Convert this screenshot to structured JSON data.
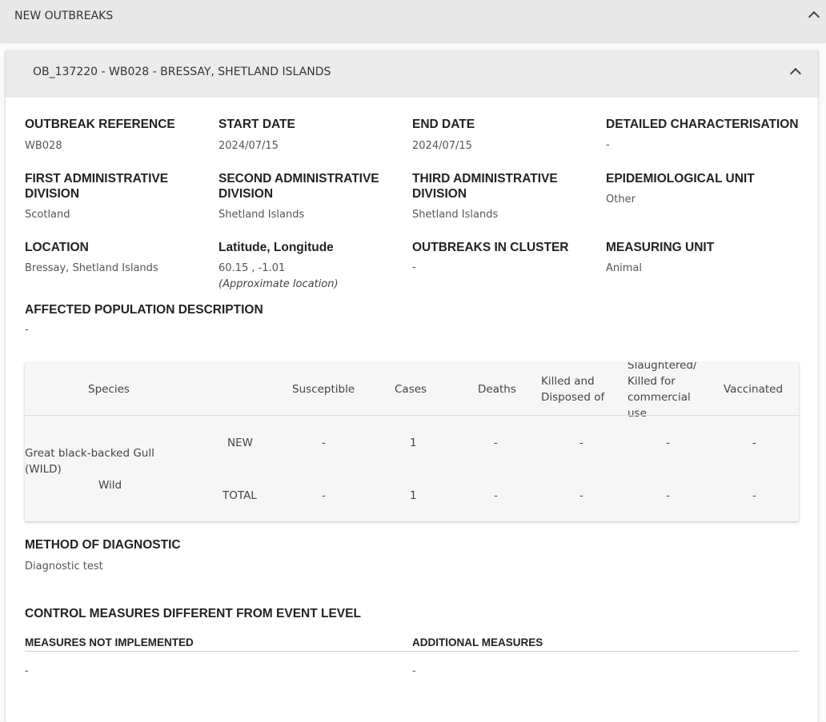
{
  "section": {
    "title": "NEW OUTBREAKS"
  },
  "outbreak": {
    "title": "OB_137220 - WB028 - BRESSAY, SHETLAND ISLANDS",
    "fields": [
      {
        "label": "OUTBREAK REFERENCE",
        "value": "WB028"
      },
      {
        "label": "START DATE",
        "value": "2024/07/15"
      },
      {
        "label": "END DATE",
        "value": "2024/07/15"
      },
      {
        "label": "DETAILED CHARACTERISATION",
        "value": "-"
      },
      {
        "label": "FIRST ADMINISTRATIVE DIVISION",
        "value": "Scotland"
      },
      {
        "label": "SECOND ADMINISTRATIVE DIVISION",
        "value": "Shetland Islands"
      },
      {
        "label": "THIRD ADMINISTRATIVE DIVISION",
        "value": "Shetland Islands"
      },
      {
        "label": "EPIDEMIOLOGICAL UNIT",
        "value": "Other"
      },
      {
        "label": "LOCATION",
        "value": "Bressay, Shetland Islands"
      },
      {
        "label": "Latitude, Longitude",
        "value": "60.15 , -1.01",
        "note": "(Approximate location)"
      },
      {
        "label": "OUTBREAKS IN CLUSTER",
        "value": "-"
      },
      {
        "label": "MEASURING UNIT",
        "value": "Animal"
      }
    ],
    "affected_population": {
      "label": "AFFECTED POPULATION DESCRIPTION",
      "value": "-"
    }
  },
  "table": {
    "headers": {
      "species": "Species",
      "susceptible": "Susceptible",
      "cases": "Cases",
      "deaths": "Deaths",
      "killed": "Killed and Disposed of",
      "slaughtered": "Slaughtered/ Killed for commercial use",
      "vaccinated": "Vaccinated"
    },
    "species_name": "Great black-backed Gull (WILD)",
    "species_type": "Wild",
    "rows": [
      {
        "label": "NEW",
        "susceptible": "-",
        "cases": "1",
        "deaths": "-",
        "killed": "-",
        "slaughtered": "-",
        "vaccinated": "-"
      },
      {
        "label": "TOTAL",
        "susceptible": "-",
        "cases": "1",
        "deaths": "-",
        "killed": "-",
        "slaughtered": "-",
        "vaccinated": "-"
      }
    ]
  },
  "diagnostic": {
    "label": "METHOD OF DIAGNOSTIC",
    "value": "Diagnostic test"
  },
  "control": {
    "title": "CONTROL MEASURES DIFFERENT FROM EVENT LEVEL",
    "not_implemented": {
      "label": "MEASURES NOT IMPLEMENTED",
      "value": "-"
    },
    "additional": {
      "label": "ADDITIONAL MEASURES",
      "value": "-"
    }
  },
  "icons": {
    "collapse": "chevron-up-icon"
  }
}
